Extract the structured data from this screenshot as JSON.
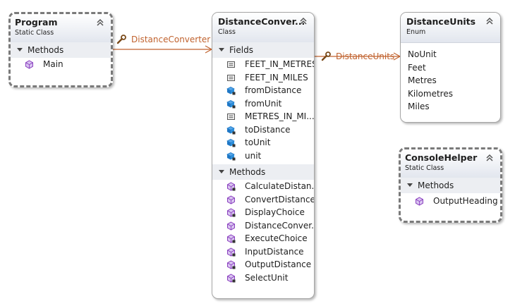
{
  "colors": {
    "connector": "#c0622e",
    "method_icon": "#8a3fbf",
    "field_icon": "#1f78c6",
    "header_gradient_end": "#e2e6ee"
  },
  "program": {
    "name": "Program",
    "stereotype": "Static Class",
    "methods_label": "Methods",
    "methods": [
      "Main"
    ]
  },
  "converter": {
    "name": "DistanceConver...",
    "stereotype": "Class",
    "fields_label": "Fields",
    "fields": [
      {
        "name": "FEET_IN_METRES",
        "icon": "constant-icon"
      },
      {
        "name": "FEET_IN_MILES",
        "icon": "constant-icon"
      },
      {
        "name": "fromDistance",
        "icon": "field-icon"
      },
      {
        "name": "fromUnit",
        "icon": "field-icon"
      },
      {
        "name": "METRES_IN_MI...",
        "icon": "constant-icon"
      },
      {
        "name": "toDistance",
        "icon": "field-icon"
      },
      {
        "name": "toUnit",
        "icon": "field-icon"
      },
      {
        "name": "unit",
        "icon": "field-icon"
      }
    ],
    "methods_label": "Methods",
    "methods": [
      {
        "name": "CalculateDistan...",
        "icon": "private-method-icon"
      },
      {
        "name": "ConvertDistance",
        "icon": "method-icon"
      },
      {
        "name": "DisplayChoice",
        "icon": "private-method-icon"
      },
      {
        "name": "DistanceConver...",
        "icon": "method-icon"
      },
      {
        "name": "ExecuteChoice",
        "icon": "private-method-icon"
      },
      {
        "name": "InputDistance",
        "icon": "private-method-icon"
      },
      {
        "name": "OutputDistance",
        "icon": "private-method-icon"
      },
      {
        "name": "SelectUnit",
        "icon": "private-method-icon"
      }
    ]
  },
  "units": {
    "name": "DistanceUnits",
    "stereotype": "Enum",
    "values": [
      "NoUnit",
      "Feet",
      "Metres",
      "Kilometres",
      "Miles"
    ]
  },
  "helper": {
    "name": "ConsoleHelper",
    "stereotype": "Static Class",
    "methods_label": "Methods",
    "methods": [
      "OutputHeading"
    ]
  },
  "associations": {
    "program_to_converter": "DistanceConverter",
    "converter_to_units": "DistanceUnits"
  }
}
